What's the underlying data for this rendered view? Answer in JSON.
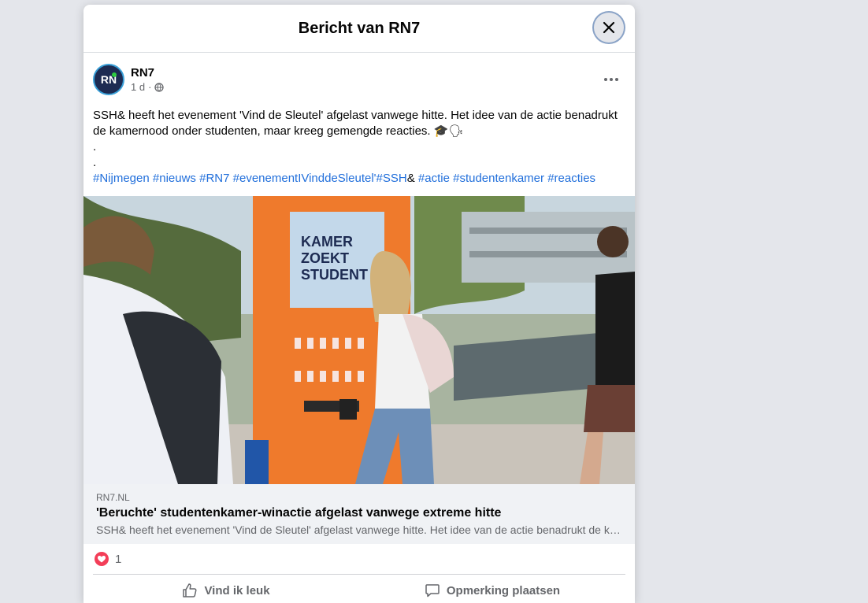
{
  "modal": {
    "title": "Bericht van RN7"
  },
  "post": {
    "page_name": "RN7",
    "avatar_text": "RN",
    "time": "1 d",
    "time_separator": "·",
    "text_line1": "SSH& heeft het evenement 'Vind de Sleutel' afgelast vanwege hitte. Het idee van de actie benadrukt de kamernood onder studenten, maar kreeg gemengde reacties.",
    "dot1": ".",
    "dot2": ".",
    "hashtags": [
      "#Nijmegen",
      "#nieuws",
      "#RN7",
      "#evenementIVinddeSleutel'#SSH",
      "#actie",
      "#studentenkamer",
      "#reacties"
    ],
    "hashtag_joiner": "&",
    "image_sign": {
      "line1": "KAMER",
      "line2": "ZOEKT",
      "line3": "STUDENT"
    }
  },
  "link_preview": {
    "domain": "RN7.NL",
    "title": "'Beruchte' studentenkamer-winactie afgelast vanwege extreme hitte",
    "description": "SSH& heeft het evenement 'Vind de Sleutel' afgelast vanwege hitte. Het idee van de actie benadrukt de kamernood onder studenten, maar kreeg gemengde reacties."
  },
  "reactions": {
    "count": "1"
  },
  "actions": {
    "like": "Vind ik leuk",
    "comment": "Opmerking plaatsen"
  },
  "colors": {
    "link": "#216fdb",
    "heart": "#f33e58",
    "brand": "#1d2b52"
  }
}
